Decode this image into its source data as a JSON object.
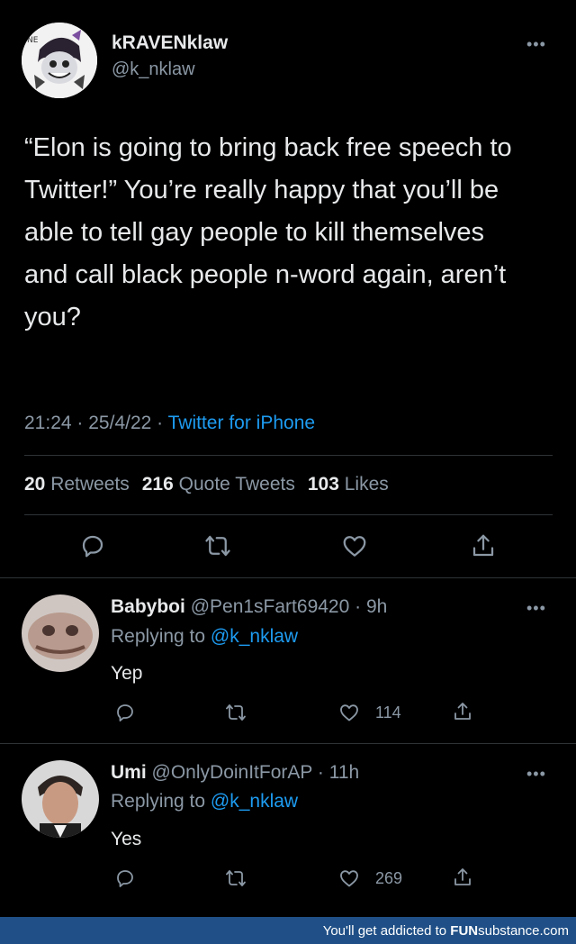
{
  "main_tweet": {
    "author_name": "kRAVENklaw",
    "author_handle": "@k_nklaw",
    "text": "“Elon is going to bring back free speech to Twitter!” You’re really happy that you’ll be able to tell gay people to kill themselves and call black people n-word again, aren’t you?",
    "time": "21:24",
    "date": "25/4/22",
    "source": "Twitter for iPhone",
    "separator": "·",
    "retweets_count": "20",
    "retweets_label": "Retweets",
    "quotes_count": "216",
    "quotes_label": "Quote Tweets",
    "likes_count": "103",
    "likes_label": "Likes",
    "more_icon": "more-horizontal-icon"
  },
  "replies": [
    {
      "name": "Babyboi",
      "handle": "@Pen1sFart69420",
      "age": "· 9h",
      "replying_prefix": "Replying to",
      "replying_to": "@k_nklaw",
      "text": "Yep",
      "likes": "114"
    },
    {
      "name": "Umi",
      "handle": "@OnlyDoinItForAP",
      "age": "· 11h",
      "replying_prefix": "Replying to",
      "replying_to": "@k_nklaw",
      "text": "Yes",
      "likes": "269"
    }
  ],
  "footer": {
    "prefix": "You'll get addicted to",
    "brand_bold": "FUN",
    "brand_rest": "substance.com"
  },
  "colors": {
    "background": "#000000",
    "text": "#e7e9ea",
    "secondary": "#8b98a5",
    "link": "#1d9bf0",
    "footer": "#1f4f86"
  }
}
